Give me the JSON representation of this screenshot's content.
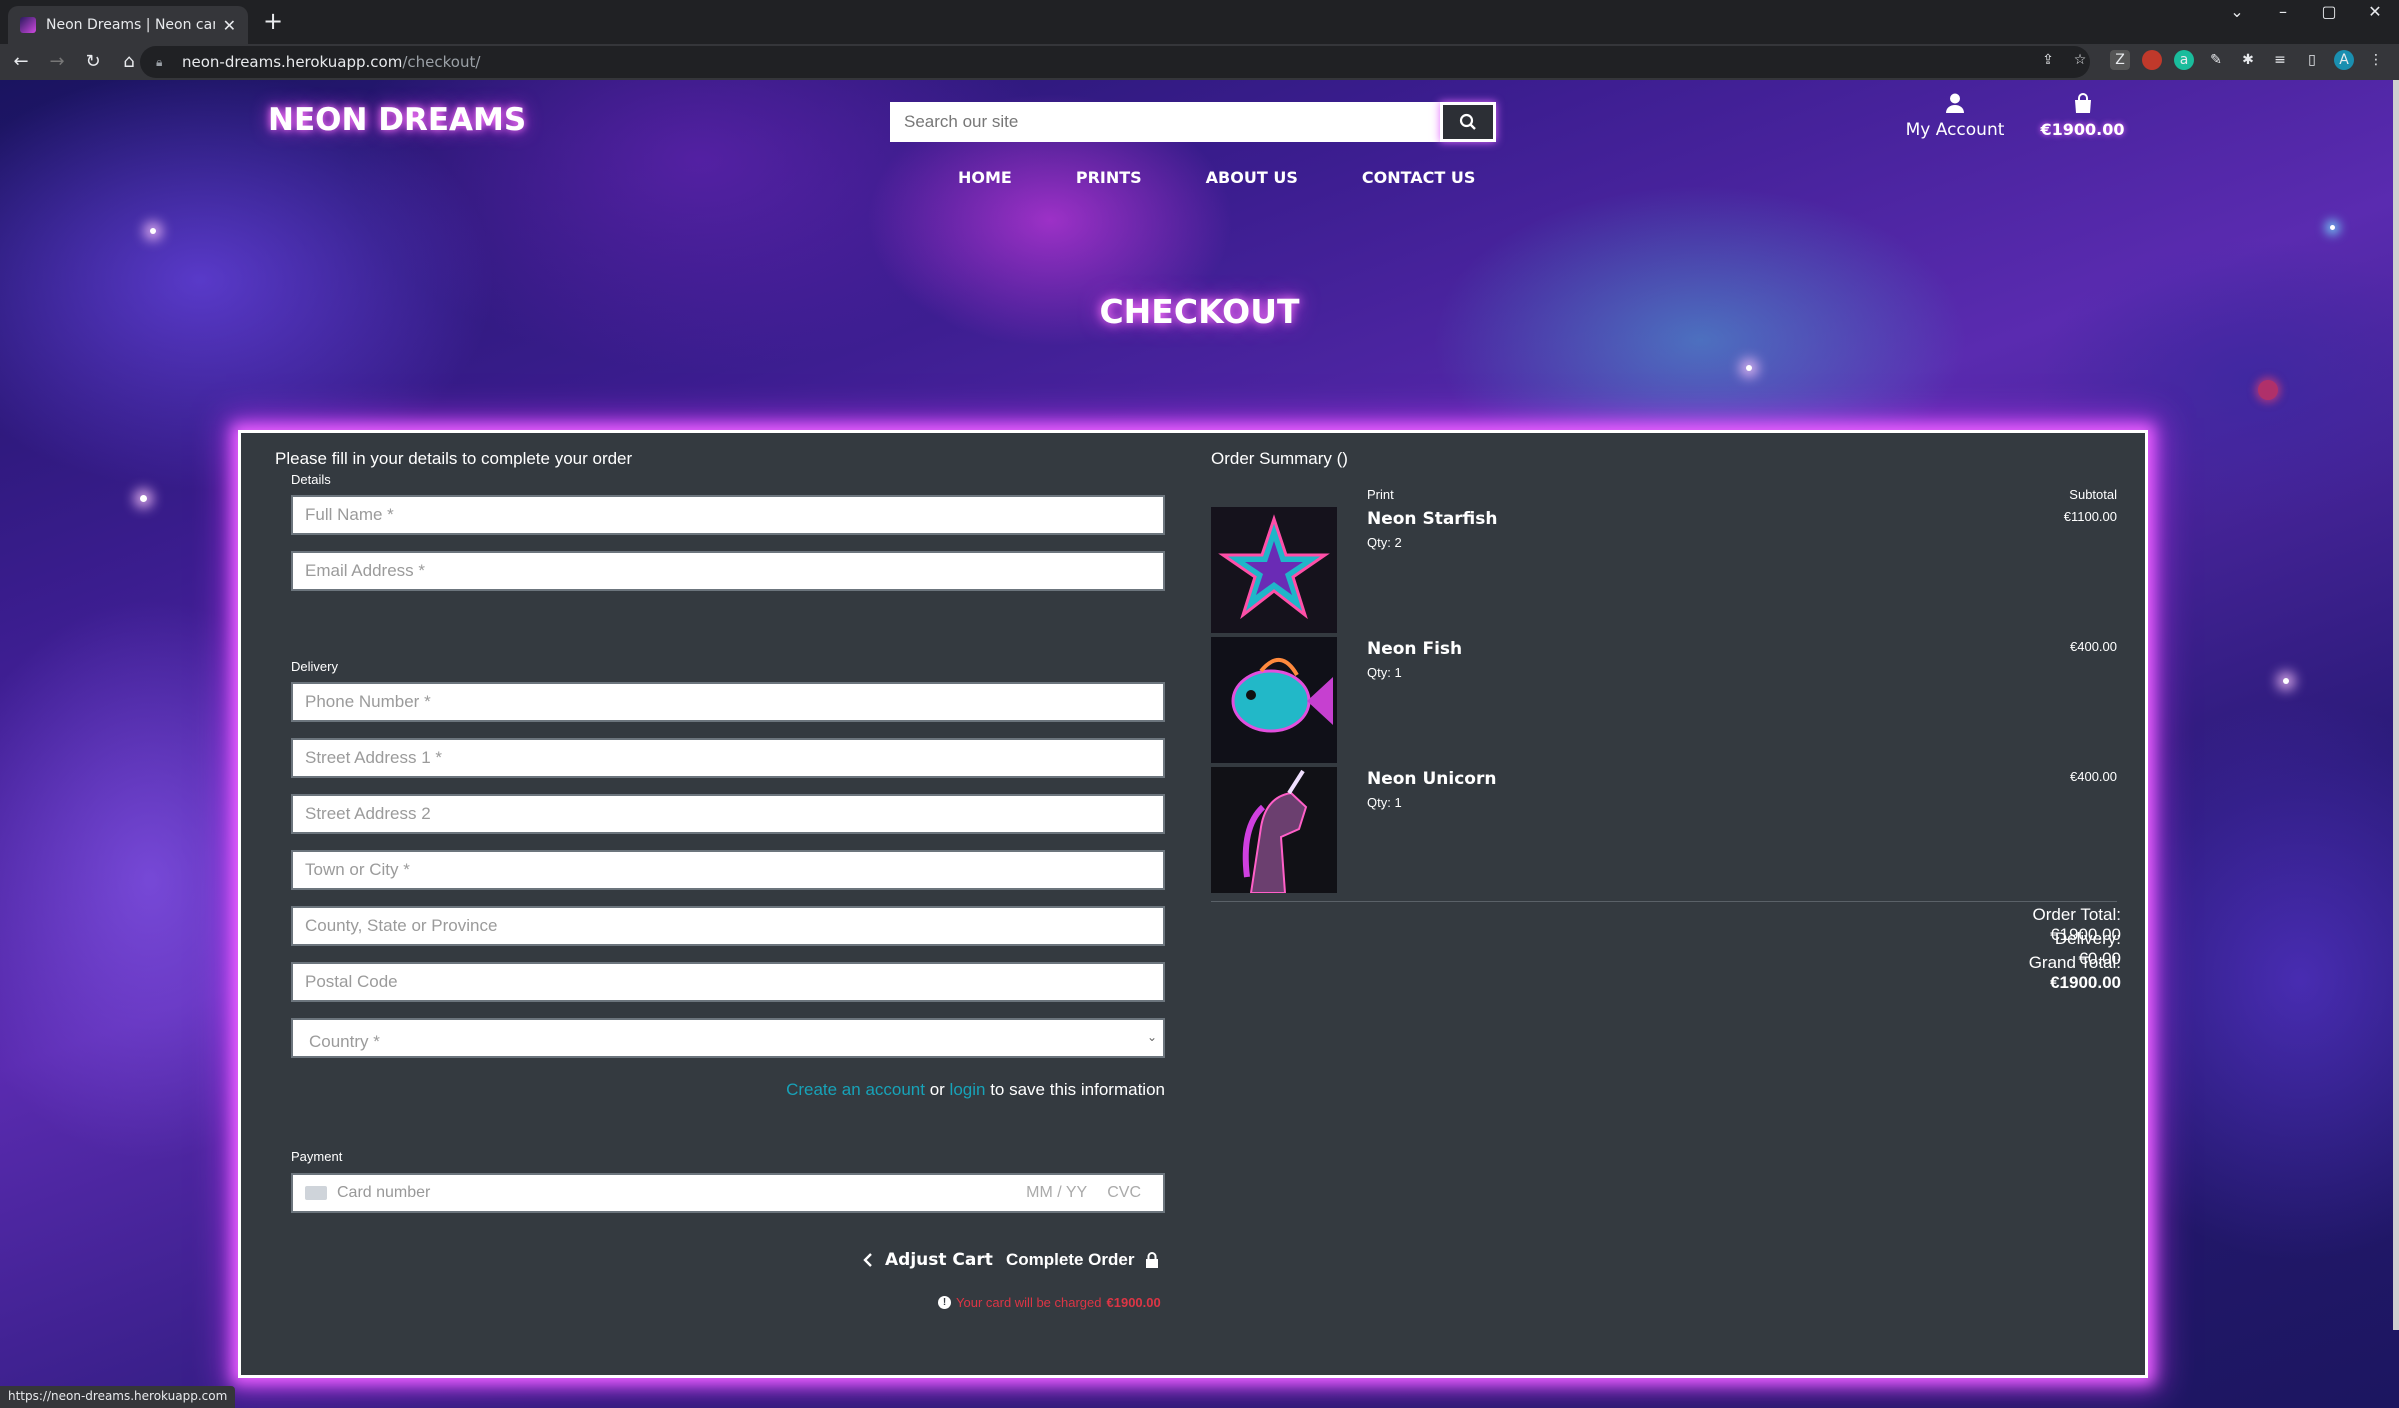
{
  "browser": {
    "tab_title": "Neon Dreams | Neon canvas prin",
    "tab_close": "✕",
    "new_tab": "+",
    "url_host": "neon-dreams.herokuapp.com",
    "url_path": "/checkout/",
    "status_url": "https://neon-dreams.herokuapp.com"
  },
  "header": {
    "logo": "NEON DREAMS",
    "search_placeholder": "Search our site",
    "account_label": "My Account",
    "cart_total": "€1900.00",
    "nav": [
      "HOME",
      "PRINTS",
      "ABOUT US",
      "CONTACT US"
    ]
  },
  "page_title": "CHECKOUT",
  "form": {
    "heading": "Please fill in your details to complete your order",
    "details_legend": "Details",
    "full_name_placeholder": "Full Name *",
    "email_placeholder": "Email Address *",
    "delivery_legend": "Delivery",
    "phone_placeholder": "Phone Number *",
    "street1_placeholder": "Street Address 1 *",
    "street2_placeholder": "Street Address 2",
    "town_placeholder": "Town or City *",
    "county_placeholder": "County, State or Province",
    "postcode_placeholder": "Postal Code",
    "country_selected": "Country *",
    "create_account": "Create an account",
    "or": " or ",
    "login": "login",
    "save_suffix": " to save this information",
    "payment_legend": "Payment",
    "card_placeholder": "Card number",
    "card_expiry": "MM / YY",
    "card_cvc": "CVC",
    "adjust_cart": "Adjust Cart",
    "complete_order": "Complete Order",
    "charge_text": "Your card will be charged",
    "charge_amount": "€1900.00"
  },
  "summary": {
    "heading": "Order Summary ()",
    "col_print": "Print",
    "col_subtotal": "Subtotal",
    "items": [
      {
        "name": "Neon Starfish",
        "qty": "Qty: 2",
        "subtotal": "€1100.00"
      },
      {
        "name": "Neon Fish",
        "qty": "Qty: 1",
        "subtotal": "€400.00"
      },
      {
        "name": "Neon Unicorn",
        "qty": "Qty: 1",
        "subtotal": "€400.00"
      }
    ],
    "order_total_label": "Order Total:",
    "order_total": "€1900.00",
    "delivery_label": "Delivery:",
    "delivery": "€0.00",
    "grand_total_label": "Grand Total:",
    "grand_total": "€1900.00"
  }
}
